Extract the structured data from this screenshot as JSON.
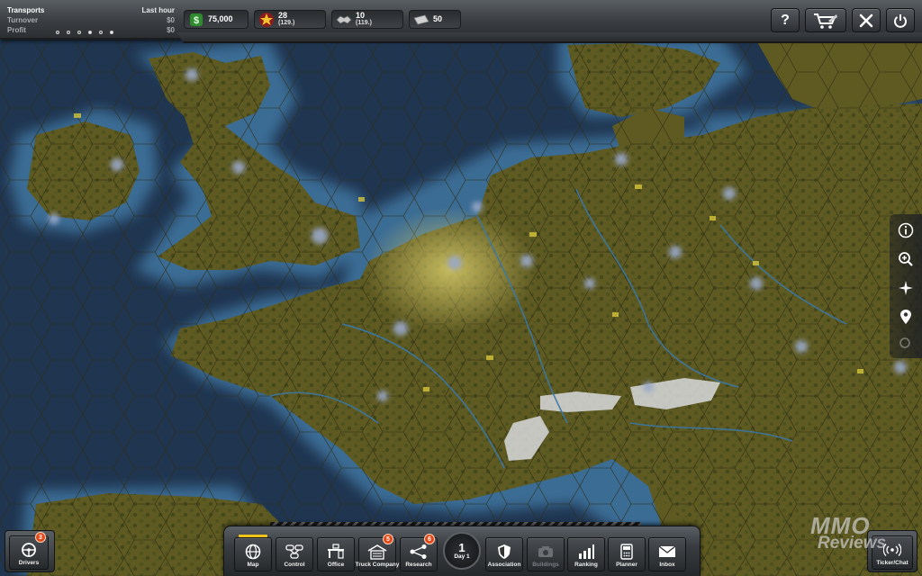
{
  "transports": {
    "title": "Transports",
    "period": "Last hour",
    "turnover_label": "Turnover",
    "turnover_value": "$0",
    "profit_label": "Profit",
    "profit_value": "$0"
  },
  "stats": {
    "money": "75,000",
    "reputation": "28",
    "reputation_rank": "(129.)",
    "company": "10",
    "company_rank": "(119.)",
    "fuel": "50"
  },
  "bottom_nav": [
    {
      "label": "Map",
      "icon": "globe-icon"
    },
    {
      "label": "Control",
      "icon": "network-icon"
    },
    {
      "label": "Office",
      "icon": "desk-icon"
    },
    {
      "label": "Truck Company",
      "icon": "garage-icon",
      "badge": "5"
    },
    {
      "label": "Research",
      "icon": "share-icon",
      "badge": "6"
    },
    {
      "label": "Association",
      "icon": "shield-icon"
    },
    {
      "label": "Buildings",
      "icon": "camera-icon"
    },
    {
      "label": "Ranking",
      "icon": "bars-icon"
    },
    {
      "label": "Planner",
      "icon": "calculator-icon"
    },
    {
      "label": "Inbox",
      "icon": "envelope-icon"
    }
  ],
  "clock": {
    "number": "1",
    "day": "Day 1"
  },
  "drivers": {
    "label": "Drivers",
    "badge": "3"
  },
  "ticker": {
    "label": "Ticker/Chat"
  },
  "watermark": {
    "line1": "MMO",
    "line2": "Reviews"
  },
  "colors": {
    "sea": "#1f3550",
    "shallow": "#3a6c94",
    "land": "#5f5a22",
    "highlight": "#c9b84a",
    "badge": "#e04a1a",
    "active_tab": "#f0c419"
  }
}
